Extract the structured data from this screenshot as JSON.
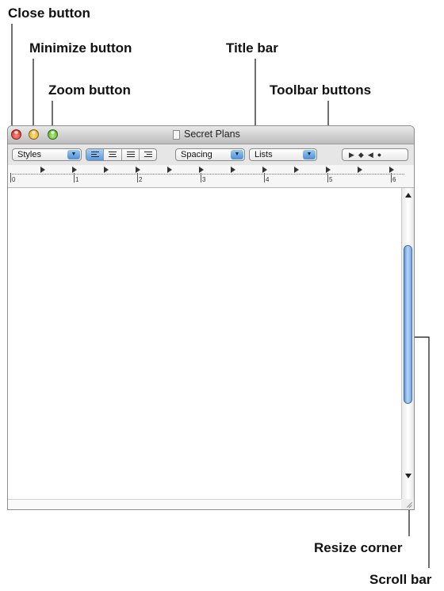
{
  "callouts": {
    "close": "Close button",
    "minimize": "Minimize button",
    "zoom": "Zoom button",
    "title_bar": "Title bar",
    "toolbar_buttons": "Toolbar buttons",
    "resize_corner": "Resize corner",
    "scroll_bar": "Scroll bar"
  },
  "window": {
    "title": "Secret Plans"
  },
  "toolbar": {
    "styles_label": "Styles",
    "spacing_label": "Spacing",
    "lists_label": "Lists",
    "nav_glyphs": "▶◆◀●"
  },
  "ruler": {
    "numbers": [
      "0",
      "1",
      "2",
      "3",
      "4",
      "5",
      "6"
    ]
  },
  "icons": {
    "close": "close-icon",
    "minimize": "minimize-icon",
    "zoom": "zoom-icon",
    "document": "document-icon"
  }
}
